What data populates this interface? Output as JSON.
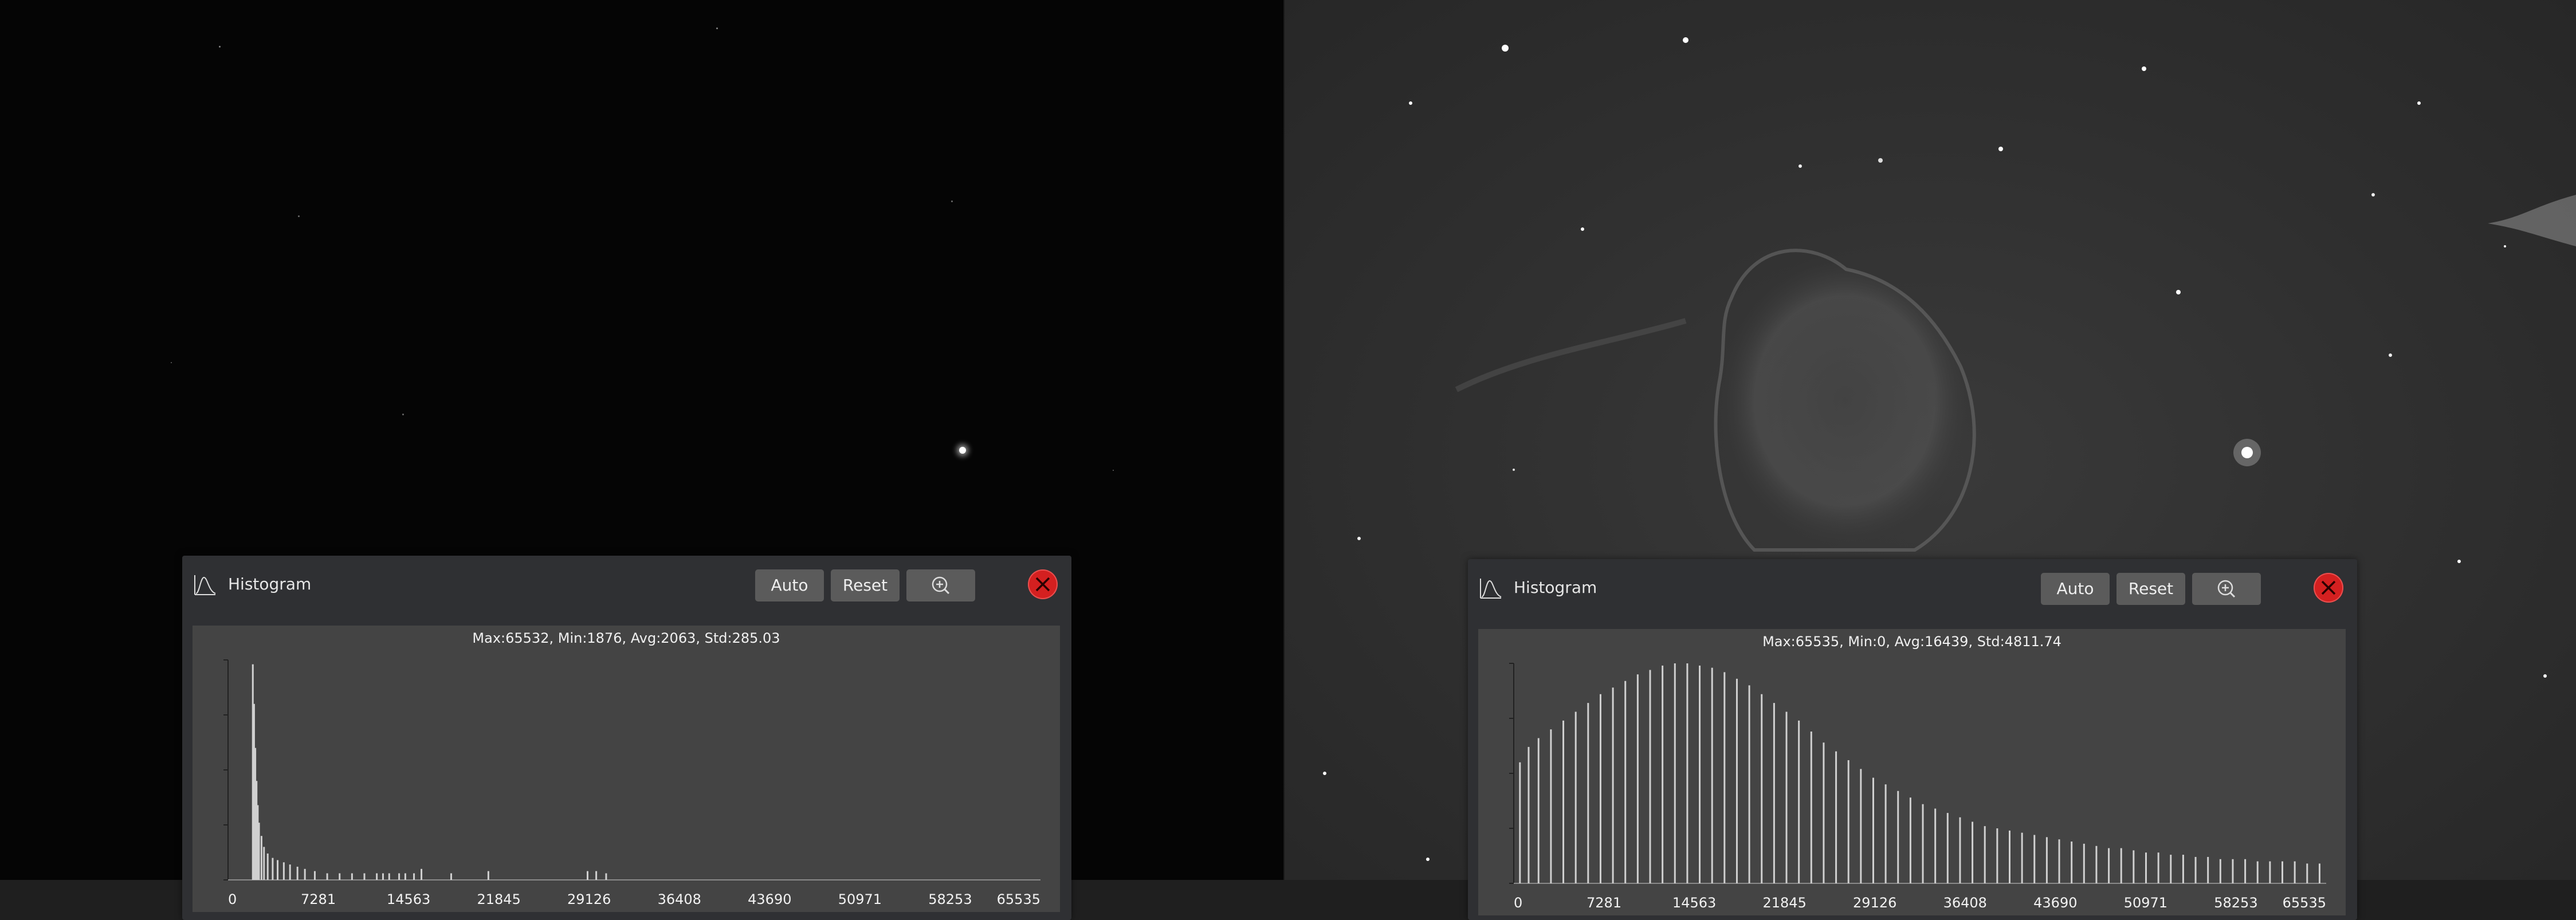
{
  "left_panel": {
    "title": "Histogram",
    "icon": "histogram-icon",
    "buttons": {
      "auto": "Auto",
      "reset": "Reset",
      "zoom": "zoom-icon",
      "close": "close-icon"
    },
    "stats": "Max:65532, Min:1876, Avg:2063, Std:285.03"
  },
  "right_panel": {
    "title": "Histogram",
    "icon": "histogram-icon",
    "buttons": {
      "auto": "Auto",
      "reset": "Reset",
      "zoom": "zoom-icon",
      "close": "close-icon"
    },
    "stats": "Max:65535, Min:0, Avg:16439, Std:4811.74"
  },
  "colors": {
    "panel_bg": "#2f3033",
    "plot_bg": "#444444",
    "button_bg": "#5b5b5b",
    "close_red": "#d42020",
    "bar_color": "#d0d0d0"
  },
  "chart_data": [
    {
      "type": "bar",
      "title": "Max:65532, Min:1876, Avg:2063, Std:285.03",
      "xlim": [
        0,
        65535
      ],
      "x_ticks": [
        "0",
        "7281",
        "14563",
        "21845",
        "29126",
        "36408",
        "43690",
        "50971",
        "58253",
        "65535"
      ],
      "series": [
        {
          "x": [
            2000,
            2100,
            2200,
            2300,
            2400,
            2500,
            2700,
            2900,
            3200,
            3600,
            4000,
            4500,
            5000,
            5600,
            6200,
            7000,
            8000,
            9000,
            10000,
            11000,
            12000,
            12500,
            13000,
            13800,
            14300,
            15000,
            15600,
            18000,
            21000,
            29000,
            29700,
            30500
          ],
          "values": [
            98,
            80,
            60,
            45,
            34,
            26,
            20,
            15,
            12,
            10,
            9,
            8,
            7,
            6,
            5,
            4,
            3,
            3,
            3,
            3,
            3,
            3,
            3,
            3,
            3,
            3,
            5,
            3,
            4,
            4,
            4,
            3
          ]
        }
      ]
    },
    {
      "type": "bar",
      "title": "Max:65535, Min:0, Avg:16439, Std:4811.74",
      "xlim": [
        0,
        65535
      ],
      "x_ticks": [
        "0",
        "7281",
        "14563",
        "21845",
        "29126",
        "36408",
        "43690",
        "50971",
        "58253",
        "65535"
      ],
      "series": [
        {
          "x": [
            500,
            1200,
            2000,
            3000,
            4000,
            5000,
            6000,
            7000,
            8000,
            9000,
            10000,
            11000,
            12000,
            13000,
            14000,
            15000,
            16000,
            17000,
            18000,
            19000,
            20000,
            21000,
            22000,
            23000,
            24000,
            25000,
            26000,
            27000,
            28000,
            29000,
            30000,
            31000,
            32000,
            33000,
            34000,
            35000,
            36000,
            37000,
            38000,
            39000,
            40000,
            41000,
            42000,
            43000,
            44000,
            45000,
            46000,
            47000,
            48000,
            49000,
            50000,
            51000,
            52000,
            53000,
            54000,
            55000,
            56000,
            57000,
            58000,
            59000,
            60000,
            61000,
            62000,
            63000,
            64000,
            65000
          ],
          "values": [
            55,
            62,
            66,
            70,
            74,
            78,
            82,
            86,
            89,
            92,
            95,
            97,
            99,
            100,
            100,
            99,
            98,
            96,
            93,
            90,
            86,
            82,
            78,
            74,
            69,
            64,
            60,
            56,
            52,
            48,
            45,
            42,
            39,
            36,
            34,
            32,
            30,
            28,
            26,
            25,
            24,
            23,
            22,
            21,
            20,
            19,
            18,
            17,
            16,
            16,
            15,
            14,
            14,
            13,
            13,
            12,
            12,
            11,
            11,
            11,
            10,
            10,
            10,
            10,
            9,
            9
          ]
        }
      ]
    }
  ]
}
